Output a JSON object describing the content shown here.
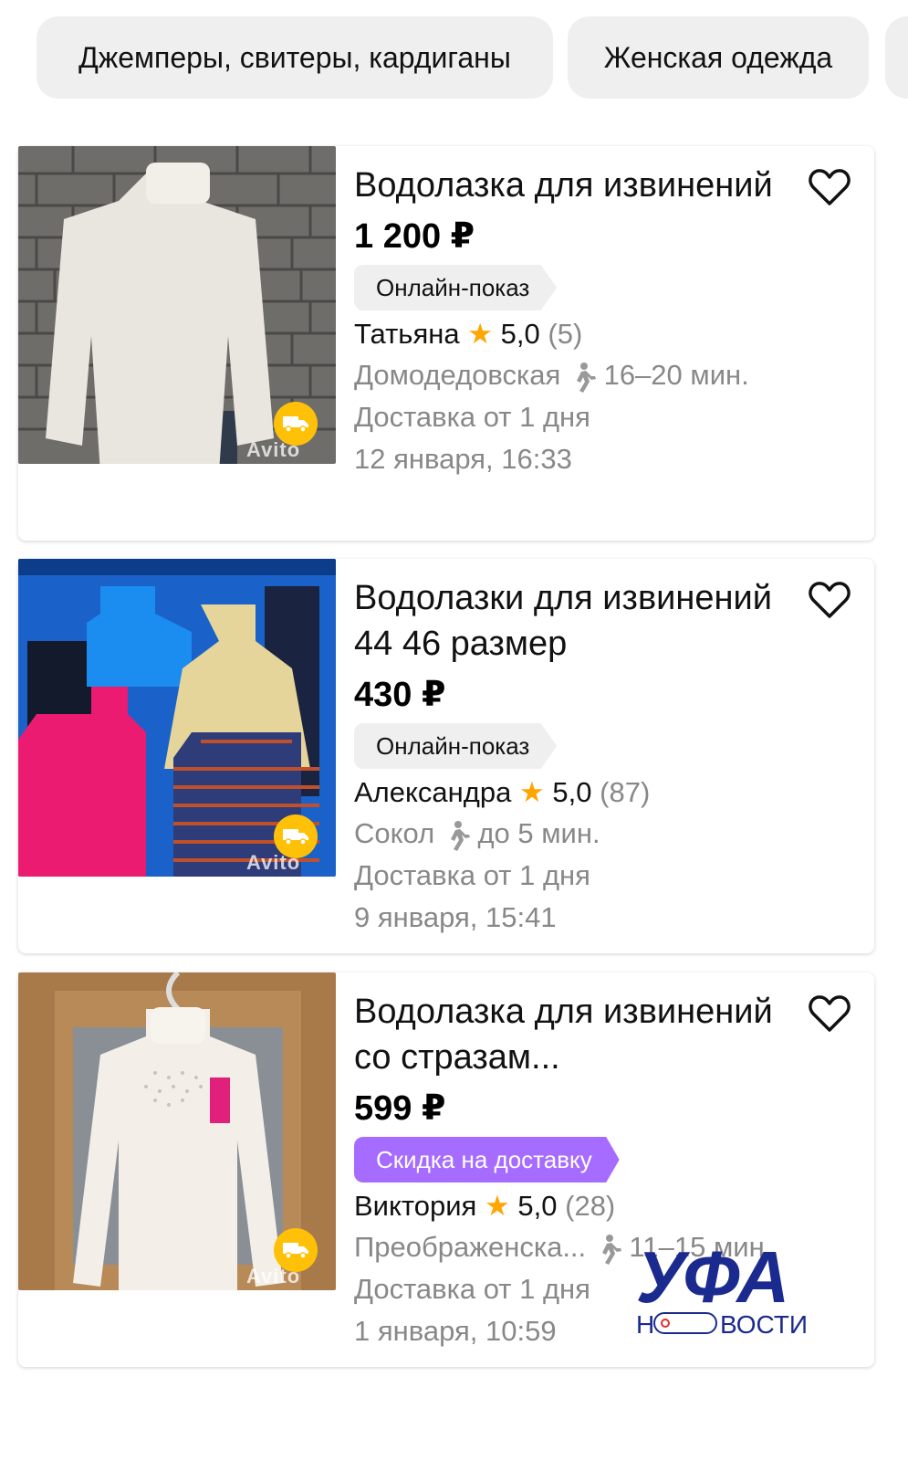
{
  "chips": [
    "Джемперы, свитеры, кардиганы",
    "Женская одежда"
  ],
  "listings": [
    {
      "title": "Водолазка для извинений",
      "price": "1 200 ₽",
      "tag": "Онлайн-показ",
      "seller": "Татьяна",
      "star": "★",
      "rating": "5,0",
      "reviews": "(5)",
      "location": "Домодедовская",
      "walk_time": "16–20 мин.",
      "delivery": "Доставка от 1 дня",
      "date": "12 января, 16:33",
      "watermark": "Avito"
    },
    {
      "title": "Водолазки для извинений 44 46 размер",
      "price": "430 ₽",
      "tag": "Онлайн-показ",
      "seller": "Александра",
      "star": "★",
      "rating": "5,0",
      "reviews": "(87)",
      "location": "Сокол",
      "walk_time": "до 5 мин.",
      "delivery": "Доставка от 1 дня",
      "date": "9 января, 15:41",
      "watermark": "Avito"
    },
    {
      "title": "Водолазка для извинений со стразам...",
      "price": "599 ₽",
      "tag": "Скидка на доставку",
      "seller": "Виктория",
      "star": "★",
      "rating": "5,0",
      "reviews": "(28)",
      "location": "Преображенска...",
      "walk_time": "11–15 мин.",
      "delivery": "Доставка от 1 дня",
      "date": "1 января, 10:59",
      "watermark": "Avito"
    }
  ],
  "logo": {
    "line1": "УФА",
    "line2_left": "Н",
    "line2_right": "ВОСТИ"
  },
  "colors": {
    "chip_bg": "#efefef",
    "tag_grey": "#efefef",
    "tag_purple": "#a66cff",
    "star": "#ffa500",
    "muted": "#888888",
    "delivery_badge": "#ffc107",
    "logo_blue": "#1b2a8f"
  },
  "icons": {
    "favorite": "heart-outline-icon",
    "walk": "walking-person-icon",
    "delivery": "truck-icon"
  }
}
